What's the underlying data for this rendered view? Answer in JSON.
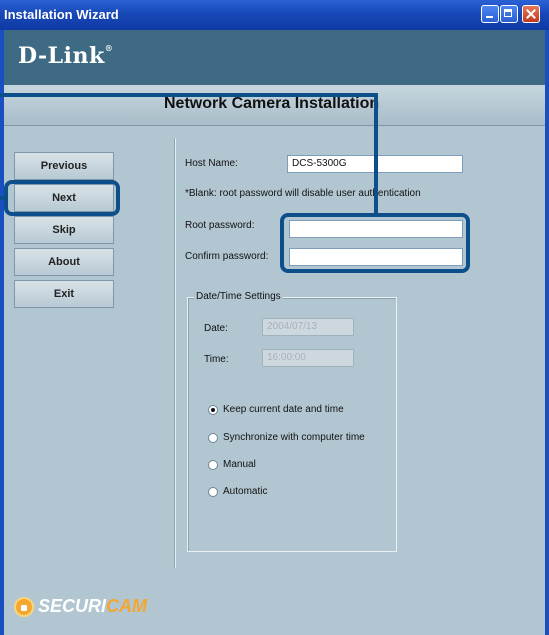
{
  "window": {
    "title": "Installation Wizard",
    "brand": "D-Link",
    "subtitle": "Network Camera Installation"
  },
  "nav": {
    "buttons": [
      "Previous",
      "Next",
      "Skip",
      "About",
      "Exit"
    ],
    "highlighted": "Next"
  },
  "form": {
    "host_name_label": "Host Name:",
    "host_name_value": "DCS-5300G",
    "blank_note": "*Blank: root password will disable user authentication",
    "root_password_label": "Root password:",
    "confirm_password_label": "Confirm password:",
    "root_password_value": "",
    "confirm_password_value": ""
  },
  "datetime": {
    "legend": "Date/Time Settings",
    "date_label": "Date:",
    "date_value": "2004/07/13",
    "time_label": "Time:",
    "time_value": "16:00:00",
    "options": [
      {
        "label": "Keep current date and time",
        "selected": true
      },
      {
        "label": "Synchronize with computer time",
        "selected": false
      },
      {
        "label": "Manual",
        "selected": false
      },
      {
        "label": "Automatic",
        "selected": false
      }
    ]
  },
  "footer": {
    "logo_part1": "SECURI",
    "logo_part2": "CAM"
  },
  "colors": {
    "callout": "#0d4f8a",
    "logo_orange": "#f3a72f"
  }
}
